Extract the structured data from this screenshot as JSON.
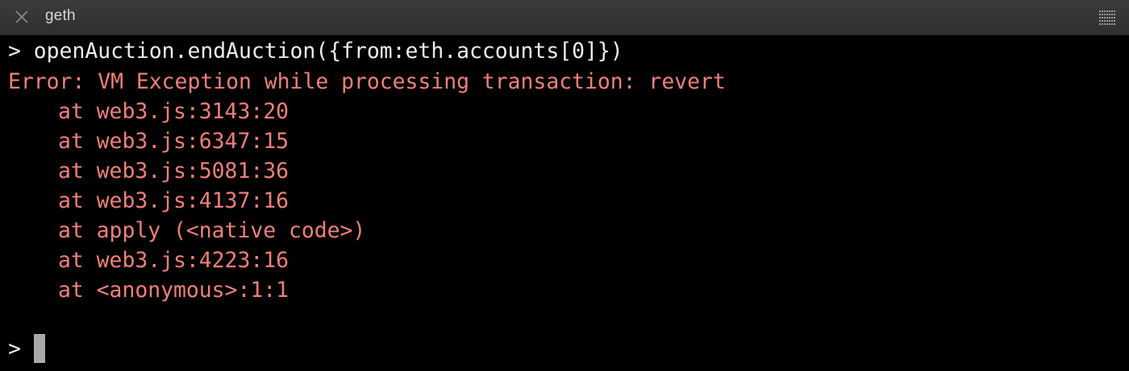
{
  "window": {
    "title": "geth",
    "close_icon": "close-icon",
    "menu_icon": "menu-grip-icon"
  },
  "terminal": {
    "colors": {
      "background": "#000000",
      "text": "#ececec",
      "error": "#f07f7a"
    },
    "command": "> openAuction.endAuction({from:eth.accounts[0]})",
    "error_message": "Error: VM Exception while processing transaction: revert",
    "stack_trace": [
      "at web3.js:3143:20",
      "at web3.js:6347:15",
      "at web3.js:5081:36",
      "at web3.js:4137:16",
      "at apply (<native code>)",
      "at web3.js:4223:16",
      "at <anonymous>:1:1"
    ],
    "prompt": ">"
  }
}
